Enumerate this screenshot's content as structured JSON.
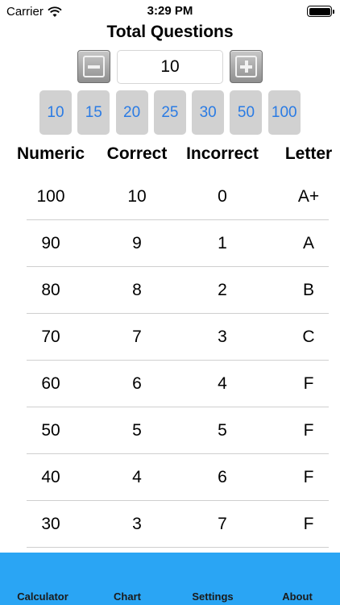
{
  "status": {
    "carrier": "Carrier",
    "time": "3:29 PM"
  },
  "title": "Total Questions",
  "stepper": {
    "value": "10"
  },
  "presets": [
    "10",
    "15",
    "20",
    "25",
    "30",
    "50",
    "100"
  ],
  "headers": {
    "numeric": "Numeric",
    "correct": "Correct",
    "incorrect": "Incorrect",
    "letter": "Letter"
  },
  "rows": [
    {
      "numeric": "100",
      "correct": "10",
      "incorrect": "0",
      "letter": "A+"
    },
    {
      "numeric": "90",
      "correct": "9",
      "incorrect": "1",
      "letter": "A"
    },
    {
      "numeric": "80",
      "correct": "8",
      "incorrect": "2",
      "letter": "B"
    },
    {
      "numeric": "70",
      "correct": "7",
      "incorrect": "3",
      "letter": "C"
    },
    {
      "numeric": "60",
      "correct": "6",
      "incorrect": "4",
      "letter": "F"
    },
    {
      "numeric": "50",
      "correct": "5",
      "incorrect": "5",
      "letter": "F"
    },
    {
      "numeric": "40",
      "correct": "4",
      "incorrect": "6",
      "letter": "F"
    },
    {
      "numeric": "30",
      "correct": "3",
      "incorrect": "7",
      "letter": "F"
    }
  ],
  "tabs": {
    "calculator": "Calculator",
    "chart": "Chart",
    "settings": "Settings",
    "about": "About"
  },
  "icons": {
    "minus": "minus-icon",
    "plus": "plus-icon",
    "wifi": "wifi-icon",
    "battery": "battery-icon"
  },
  "colors": {
    "accent": "#2a7be4",
    "tabbar": "#2aa5f4",
    "preset_bg": "#d1d1d1"
  }
}
